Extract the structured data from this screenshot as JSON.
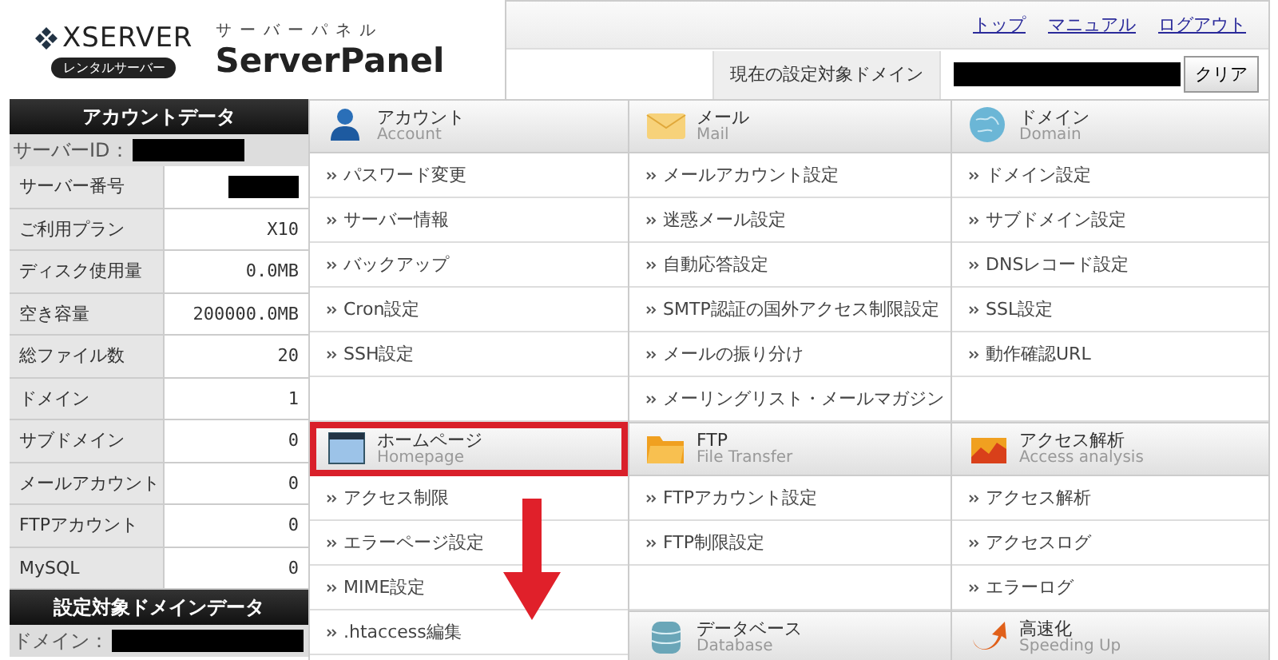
{
  "header": {
    "logo": {
      "brand": "XSERVER",
      "badge": "レンタルサーバー"
    },
    "product": {
      "kana": "サーバーパネル",
      "name": "ServerPanel"
    },
    "links": [
      "トップ",
      "マニュアル",
      "ログアウト"
    ],
    "domain_label": "現在の設定対象ドメイン",
    "domain_value": {
      "redacted": true
    },
    "clear_button": "クリア"
  },
  "sidebar": {
    "account_title": "アカウントデータ",
    "server_id": {
      "label": "サーバーID：",
      "redacted": true
    },
    "rows": [
      {
        "label": "サーバー番号",
        "redacted": true
      },
      {
        "label": "ご利用プラン",
        "value": "X10",
        "redacted": false
      },
      {
        "label": "ディスク使用量",
        "value": "0.0MB",
        "redacted": false
      },
      {
        "label": "空き容量",
        "value": "200000.0MB",
        "redacted": false
      },
      {
        "label": "総ファイル数",
        "value": "20",
        "redacted": false
      },
      {
        "label": "ドメイン",
        "value": "1",
        "redacted": false
      },
      {
        "label": "サブドメイン",
        "value": "0",
        "redacted": false
      },
      {
        "label": "メールアカウント",
        "value": "0",
        "redacted": false
      },
      {
        "label": "FTPアカウント",
        "value": "0",
        "redacted": false
      },
      {
        "label": "MySQL",
        "value": "0",
        "redacted": false
      }
    ],
    "domain_title": "設定対象ドメインデータ",
    "domain": {
      "label": "ドメイン：",
      "redacted": true
    }
  },
  "columns": [
    {
      "sections": [
        {
          "title": "アカウント",
          "subtitle": "Account",
          "highlighted": false,
          "items": [
            {
              "kind": "link",
              "label": "パスワード変更"
            },
            {
              "kind": "link",
              "label": "サーバー情報"
            },
            {
              "kind": "link",
              "label": "バックアップ"
            },
            {
              "kind": "link",
              "label": "Cron設定"
            },
            {
              "kind": "link",
              "label": "SSH設定"
            },
            {
              "kind": "blank"
            }
          ]
        },
        {
          "title": "ホームページ",
          "subtitle": "Homepage",
          "highlighted": true,
          "items": [
            {
              "kind": "link",
              "label": "アクセス制限"
            },
            {
              "kind": "link",
              "label": "エラーページ設定"
            },
            {
              "kind": "link",
              "label": "MIME設定"
            },
            {
              "kind": "link",
              "label": ".htaccess編集"
            }
          ]
        }
      ]
    },
    {
      "sections": [
        {
          "title": "メール",
          "subtitle": "Mail",
          "highlighted": false,
          "items": [
            {
              "kind": "link",
              "label": "メールアカウント設定"
            },
            {
              "kind": "link",
              "label": "迷惑メール設定"
            },
            {
              "kind": "link",
              "label": "自動応答設定"
            },
            {
              "kind": "link",
              "label": "SMTP認証の国外アクセス制限設定"
            },
            {
              "kind": "link",
              "label": "メールの振り分け"
            },
            {
              "kind": "link",
              "label": "メーリングリスト・メールマガジン"
            }
          ]
        },
        {
          "title": "FTP",
          "subtitle": "File Transfer",
          "highlighted": false,
          "items": [
            {
              "kind": "link",
              "label": "FTPアカウント設定"
            },
            {
              "kind": "link",
              "label": "FTP制限設定"
            },
            {
              "kind": "blank"
            }
          ]
        },
        {
          "title": "データベース",
          "subtitle": "Database",
          "highlighted": false
        }
      ]
    },
    {
      "sections": [
        {
          "title": "ドメイン",
          "subtitle": "Domain",
          "highlighted": false,
          "items": [
            {
              "kind": "link",
              "label": "ドメイン設定"
            },
            {
              "kind": "link",
              "label": "サブドメイン設定"
            },
            {
              "kind": "link",
              "label": "DNSレコード設定"
            },
            {
              "kind": "link",
              "label": "SSL設定"
            },
            {
              "kind": "link",
              "label": "動作確認URL"
            },
            {
              "kind": "blank"
            }
          ]
        },
        {
          "title": "アクセス解析",
          "subtitle": "Access analysis",
          "highlighted": false,
          "items": [
            {
              "kind": "link",
              "label": "アクセス解析"
            },
            {
              "kind": "link",
              "label": "アクセスログ"
            },
            {
              "kind": "link",
              "label": "エラーログ"
            }
          ]
        },
        {
          "title": "高速化",
          "subtitle": "Speeding Up",
          "highlighted": false
        }
      ]
    }
  ]
}
